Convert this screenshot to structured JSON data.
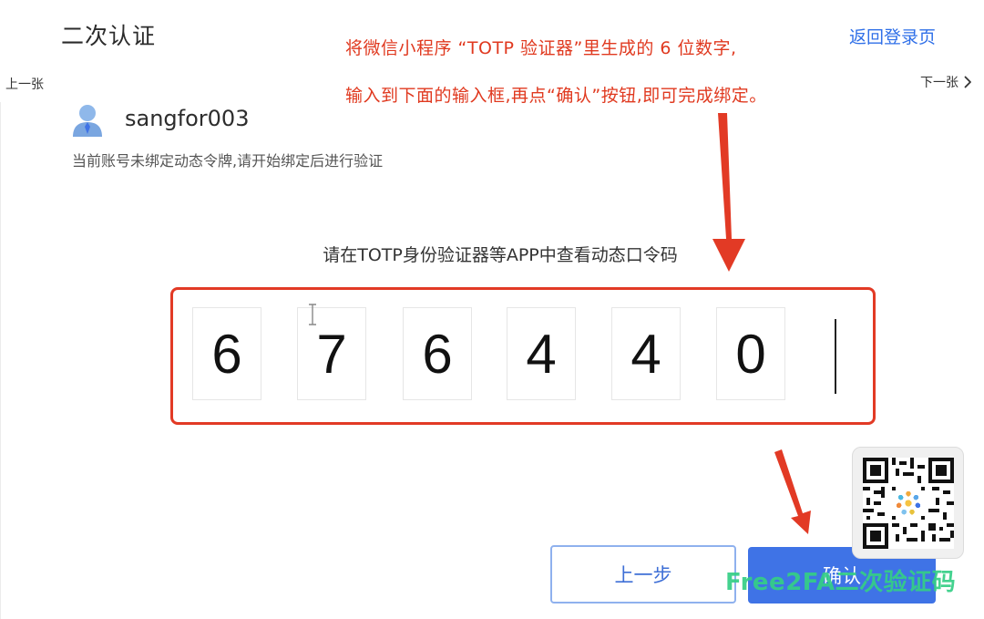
{
  "header": {
    "title": "二次认证",
    "back_link": "返回登录页"
  },
  "nav": {
    "prev": "上一张",
    "next": "下一张"
  },
  "annotation": {
    "line1": "将微信小程序 “TOTP 验证器”里生成的 6 位数字,",
    "line2": "输入到下面的输入框,再点“确认”按钮,即可完成绑定。",
    "color": "#e0391f"
  },
  "account": {
    "username": "sangfor003",
    "notice": "当前账号未绑定动态令牌,请开始绑定后进行验证"
  },
  "verification": {
    "prompt": "请在TOTP身份验证器等APP中查看动态口令码",
    "digits": [
      "6",
      "7",
      "6",
      "4",
      "4",
      "0"
    ]
  },
  "buttons": {
    "prev_step": "上一步",
    "confirm": "确认"
  },
  "watermark": {
    "text": "Free2FA二次验证码"
  },
  "colors": {
    "primary": "#3f73e6",
    "link": "#2f6fe8",
    "highlight": "#e23a25",
    "watermark": "#35cf86"
  },
  "icons": {
    "avatar": "user-avatar-icon",
    "next": "chevron-right-icon",
    "qr": "qr-code-icon"
  }
}
